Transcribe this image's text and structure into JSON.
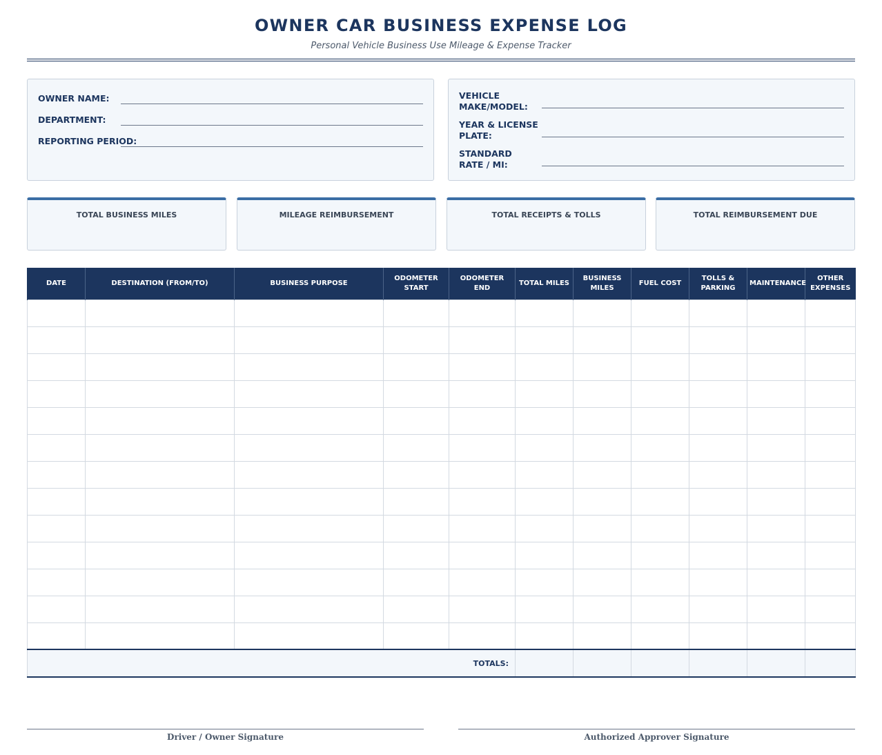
{
  "header": {
    "title": "OWNER CAR BUSINESS EXPENSE LOG",
    "subtitle": "Personal Vehicle Business Use Mileage & Expense Tracker"
  },
  "owner_info": {
    "owner_name_label": "OWNER NAME:",
    "department_label": "DEPARTMENT:",
    "reporting_period_label": "REPORTING PERIOD:"
  },
  "vehicle_info": {
    "make_model_label": "VEHICLE MAKE/MODEL:",
    "year_plate_label": "YEAR & LICENSE PLATE:",
    "rate_label": "STANDARD RATE / MI:"
  },
  "summary": {
    "total_business_miles": "TOTAL BUSINESS MILES",
    "mileage_reimbursement": "MILEAGE REIMBURSEMENT",
    "total_receipts_tolls": "TOTAL RECEIPTS & TOLLS",
    "total_reimbursement_due": "TOTAL REIMBURSEMENT DUE"
  },
  "table": {
    "columns": [
      "DATE",
      "DESTINATION (FROM/TO)",
      "BUSINESS PURPOSE",
      "ODOMETER START",
      "ODOMETER END",
      "TOTAL MILES",
      "BUSINESS MILES",
      "FUEL COST",
      "TOLLS & PARKING",
      "MAINTENANCE",
      "OTHER EXPENSES"
    ],
    "totals_label": "TOTALS:"
  },
  "signatures": {
    "driver": "Driver / Owner Signature",
    "approver": "Authorized Approver Signature"
  },
  "colors": {
    "primary": "#1c355e",
    "accent": "#3b6ea5",
    "panel": "#f3f7fb"
  }
}
